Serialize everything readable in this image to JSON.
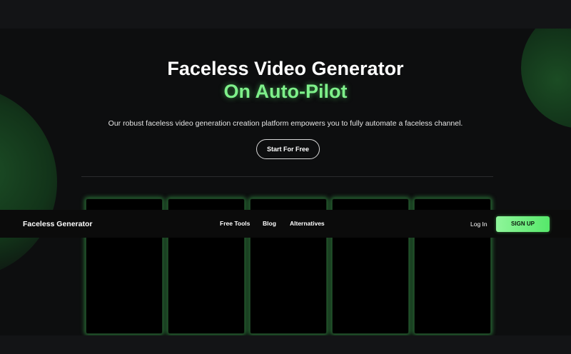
{
  "hero": {
    "title_line1": "Faceless Video Generator",
    "title_line2": "On Auto-Pilot",
    "subtitle": "Our robust faceless video generation creation platform empowers you to fully automate a faceless channel.",
    "cta_label": "Start For Free"
  },
  "navbar": {
    "brand": "Faceless Generator",
    "links": [
      "Free Tools",
      "Blog",
      "Alternatives"
    ],
    "login_label": "Log In",
    "signup_label": "SIGN UP"
  },
  "colors": {
    "accent": "#7ef08a",
    "button_gradient_start": "#8ff59a",
    "button_gradient_end": "#56e86a",
    "background": "#0d0e0f"
  }
}
